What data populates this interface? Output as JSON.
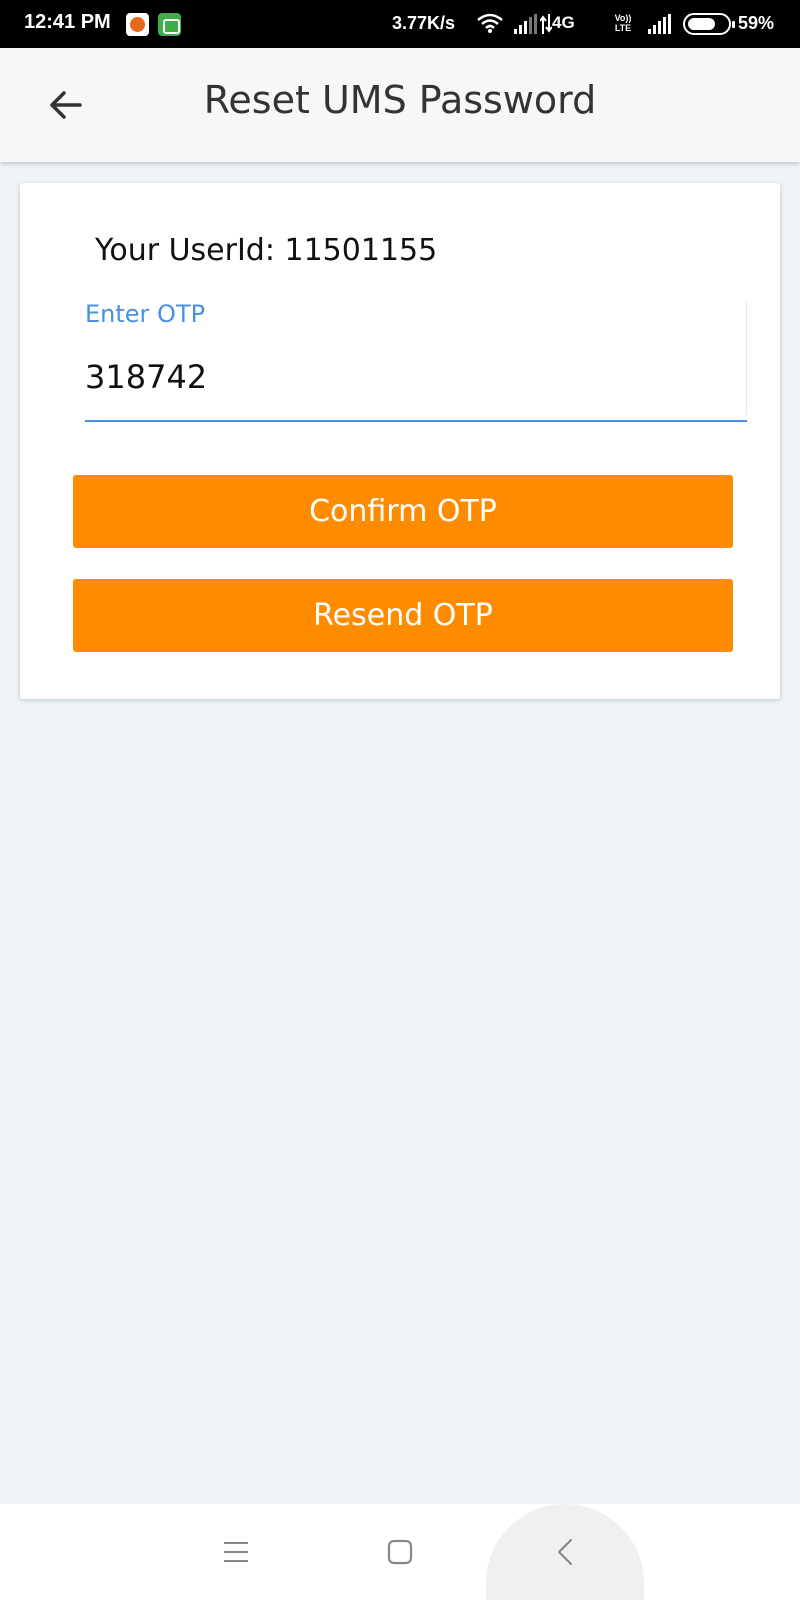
{
  "status_bar": {
    "time": "12:41 PM",
    "network_speed": "3.77K/s",
    "data_type": "4G",
    "volte": "Vo)) LTE",
    "battery": "59%",
    "icons": [
      "app-icon",
      "app-icon",
      "wifi-icon",
      "signal-icon",
      "data-arrows-icon",
      "signal-icon",
      "battery-icon"
    ]
  },
  "appbar": {
    "title": "Reset UMS Password",
    "back_icon": "arrow-left-icon"
  },
  "card": {
    "user_id_text": "Your UserId: 11501155",
    "otp_field": {
      "label": "Enter OTP",
      "value": "318742"
    },
    "confirm_label": "Confirm OTP",
    "resend_label": "Resend OTP"
  },
  "nav_bar": {
    "icons": [
      "menu-icon",
      "home-square-icon",
      "back-chevron-icon"
    ]
  },
  "colors": {
    "accent": "#ff8c00",
    "field_focus": "#4a90e2",
    "background": "#eff4f7",
    "status_bar": "#000000"
  }
}
